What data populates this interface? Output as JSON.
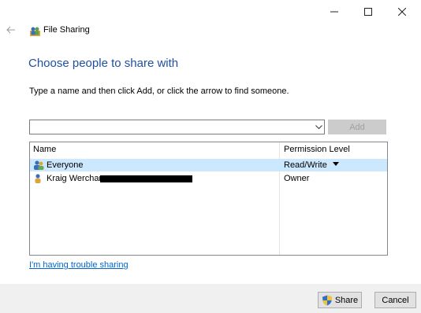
{
  "window": {
    "title": "File Sharing",
    "minimize_glyph": "–",
    "maximize_glyph": "☐",
    "close_glyph": "✕"
  },
  "header": {
    "back_icon": "back-arrow-icon",
    "app_icon": "people-icon",
    "title": "File Sharing"
  },
  "main": {
    "heading": "Choose people to share with",
    "instruction": "Type a name and then click Add, or click the arrow to find someone."
  },
  "picker": {
    "input_value": "",
    "add_label": "Add"
  },
  "list": {
    "columns": [
      "Name",
      "Permission Level"
    ],
    "rows": [
      {
        "name": "Everyone",
        "permission": "Read/Write",
        "icon": "group-users-icon",
        "selected": true
      },
      {
        "name": "Kraig Werchan",
        "permission": "Owner",
        "icon": "user-icon",
        "selected": false
      }
    ]
  },
  "trouble_link": "I'm having trouble sharing",
  "footer": {
    "share_label": "Share",
    "cancel_label": "Cancel"
  },
  "colors": {
    "heading": "#1f4fa3",
    "selection": "#cce8ff",
    "link": "#0066cc",
    "footer_bg": "#f0f0f0"
  }
}
